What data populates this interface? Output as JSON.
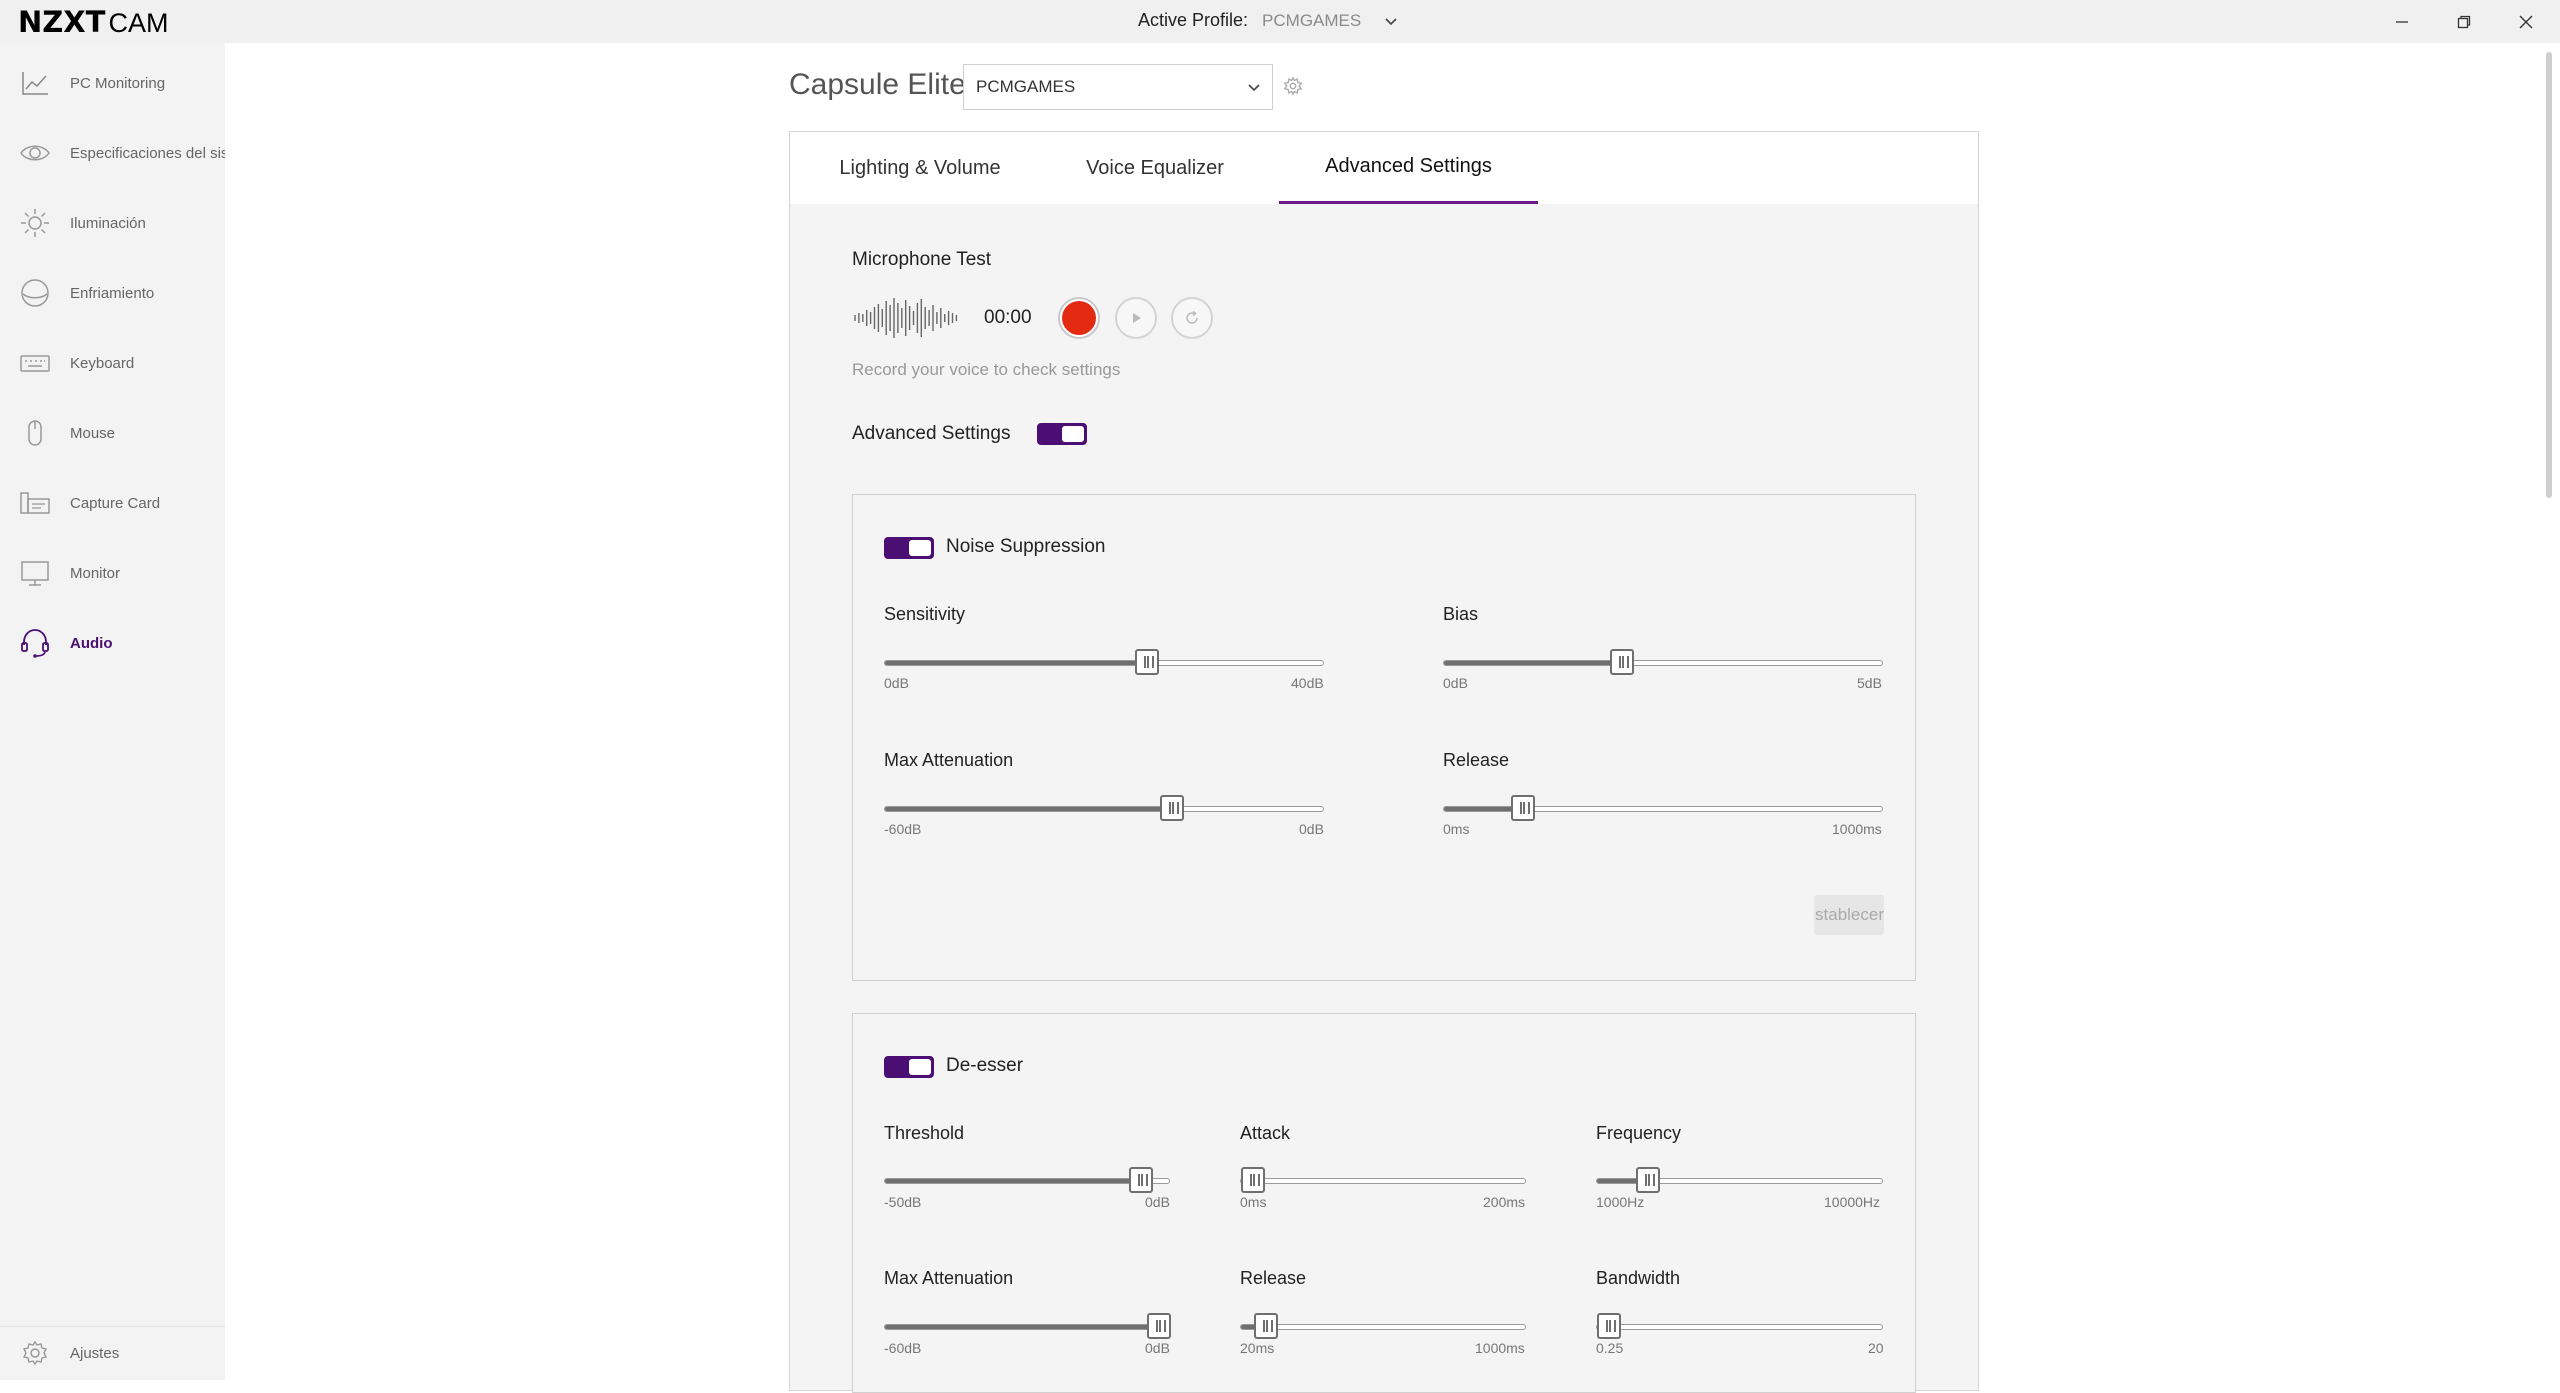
{
  "app": {
    "brand": "NZXT",
    "product": "CAM",
    "active_profile_label": "Active Profile:",
    "active_profile_value": "PCMGAMES"
  },
  "sidebar": {
    "items": [
      {
        "label": "PC Monitoring",
        "icon": "chart-icon"
      },
      {
        "label": "Especificaciones del sis",
        "icon": "eye-icon"
      },
      {
        "label": "Iluminación",
        "icon": "sun-icon"
      },
      {
        "label": "Enfriamiento",
        "icon": "fan-icon"
      },
      {
        "label": "Keyboard",
        "icon": "keyboard-icon"
      },
      {
        "label": "Mouse",
        "icon": "mouse-icon"
      },
      {
        "label": "Capture Card",
        "icon": "capture-card-icon"
      },
      {
        "label": "Monitor",
        "icon": "monitor-icon"
      },
      {
        "label": "Audio",
        "icon": "headset-icon",
        "active": true
      }
    ],
    "settings_label": "Ajustes"
  },
  "device": {
    "title": "Capsule Elite",
    "profile_selected": "PCMGAMES"
  },
  "tabs": [
    {
      "label": "Lighting & Volume"
    },
    {
      "label": "Voice Equalizer"
    },
    {
      "label": "Advanced Settings",
      "active": true
    }
  ],
  "mic_test": {
    "title": "Microphone Test",
    "timer": "00:00",
    "hint": "Record your voice to check settings"
  },
  "advanced_settings": {
    "label": "Advanced Settings",
    "enabled": true
  },
  "noise_suppression": {
    "title": "Noise Suppression",
    "enabled": true,
    "reset_label": "Restablecer",
    "sliders": {
      "sensitivity": {
        "label": "Sensitivity",
        "min": "0dB",
        "max": "40dB",
        "level": 0.6
      },
      "bias": {
        "label": "Bias",
        "min": "0dB",
        "max": "5dB",
        "level": 0.4
      },
      "max_attenuation": {
        "label": "Max Attenuation",
        "min": "-60dB",
        "max": "0dB",
        "level": 0.66
      },
      "release": {
        "label": "Release",
        "min": "0ms",
        "max": "1000ms",
        "level": 0.16
      }
    }
  },
  "de_esser": {
    "title": "De-esser",
    "enabled": true,
    "sliders": {
      "threshold": {
        "label": "Threshold",
        "min": "-50dB",
        "max": "0dB",
        "level": 0.93
      },
      "attack": {
        "label": "Attack",
        "min": "0ms",
        "max": "200ms",
        "level": 0.0
      },
      "frequency": {
        "label": "Frequency",
        "min": "1000Hz",
        "max": "10000Hz",
        "level": 0.15
      },
      "max_attenuation": {
        "label": "Max Attenuation",
        "min": "-60dB",
        "max": "0dB",
        "level": 1.0
      },
      "release": {
        "label": "Release",
        "min": "20ms",
        "max": "1000ms",
        "level": 0.05
      },
      "bandwidth": {
        "label": "Bandwidth",
        "min": "0.25",
        "max": "20",
        "level": 0.0
      }
    }
  },
  "colors": {
    "accent": "#4b0f73",
    "record": "#e42b12"
  }
}
